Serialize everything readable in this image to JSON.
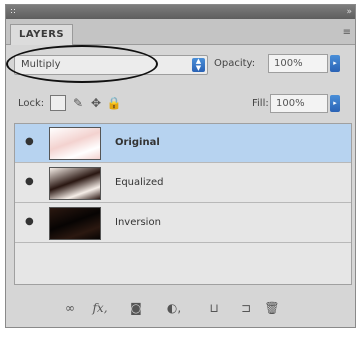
{
  "panel": {
    "tab_label": "LAYERS",
    "menu_icon": "panel-menu-icon"
  },
  "blend": {
    "mode": "Multiply",
    "opacity_label": "Opacity:",
    "opacity_value": "100%"
  },
  "lock": {
    "label": "Lock:",
    "fill_label": "Fill:",
    "fill_value": "100%"
  },
  "layers": [
    {
      "name": "Original",
      "selected": true,
      "visible": true,
      "thumb_colors": [
        "#f3d2cf",
        "#ffffff"
      ]
    },
    {
      "name": "Equalized",
      "selected": false,
      "visible": true,
      "thumb_colors": [
        "#2a1712",
        "#f6eee8"
      ]
    },
    {
      "name": "Inversion",
      "selected": false,
      "visible": true,
      "thumb_colors": [
        "#070403",
        "#2b1810"
      ]
    }
  ],
  "footer": {
    "icons": [
      "link-layers-icon",
      "layer-style-fx-icon",
      "add-mask-icon",
      "adjustment-layer-icon",
      "new-group-icon",
      "new-layer-icon",
      "delete-layer-icon"
    ],
    "fx_label": "fx"
  },
  "colors": {
    "selection": "#b7d3f0",
    "accent": "#2a62b5"
  }
}
